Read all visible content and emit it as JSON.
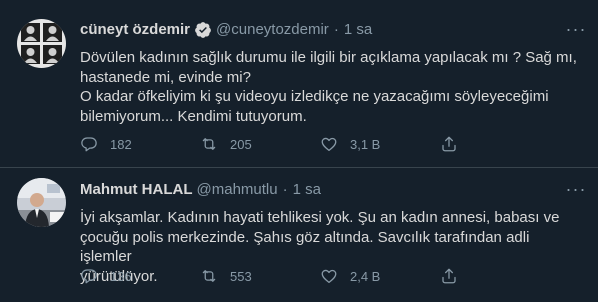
{
  "tweets": [
    {
      "author_name": "cüneyt özdemir",
      "verified": true,
      "handle": "@cuneytozdemir",
      "separator": "·",
      "time": "1 sa",
      "lines": [
        "Dövülen kadının sağlık durumu ile ilgili bir açıklama yapılacak mı ? Sağ mı,",
        "hastanede mi, evinde mi?",
        "O kadar öfkeliyim ki şu videoyu izledikçe ne yazacağımı söyleyeceğimi",
        "bilemiyorum... Kendimi tutuyorum."
      ],
      "replies": "182",
      "retweets": "205",
      "likes": "3,1 B"
    },
    {
      "author_name": "Mahmut HALAL",
      "verified": false,
      "handle": "@mahmutlu",
      "separator": "·",
      "time": "1 sa",
      "lines": [
        "İyi akşamlar. Kadının hayati tehlikesi yok. Şu an kadın annesi, babası ve",
        "çocuğu polis merkezinde. Şahıs göz altında. Savcılık tarafından adli işlemler",
        "yürütülüyor."
      ],
      "replies": "136",
      "retweets": "553",
      "likes": "2,4 B"
    }
  ],
  "icons": {
    "reply": "reply-icon",
    "retweet": "retweet-icon",
    "like": "heart-icon",
    "share": "share-icon",
    "more": "more-icon",
    "verified": "verified-badge-icon"
  },
  "colors": {
    "background": "#15202b",
    "text": "#d9d9d9",
    "muted": "#8899a6",
    "divider": "#38444d",
    "verified": "#d9d9d9"
  },
  "more_glyph": "···"
}
